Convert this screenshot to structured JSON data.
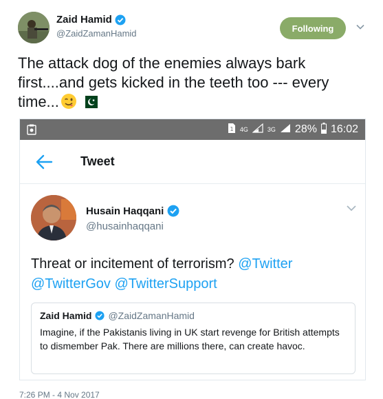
{
  "outer_tweet": {
    "name": "Zaid Hamid",
    "handle": "@ZaidZamanHamid",
    "follow_label": "Following",
    "text": "The attack dog of the enemies always bark first....and gets kicked in the teeth too --- every time...",
    "timestamp": "7:26 PM - 4 Nov 2017"
  },
  "status_bar": {
    "network_4g": "4G",
    "network_3g": "3G",
    "battery": "28%",
    "time": "16:02"
  },
  "app_header": {
    "title": "Tweet"
  },
  "inner_tweet": {
    "name": "Husain Haqqani",
    "handle": "@husainhaqqani",
    "text_plain": "Threat or incitement of terrorism? ",
    "mention1": "@Twitter",
    "mention2": "@TwitterGov",
    "mention3": "@TwitterSupport"
  },
  "quoted_tweet": {
    "name": "Zaid Hamid",
    "handle": "@ZaidZamanHamid",
    "text": "Imagine, if the Pakistanis living in UK start revenge for British attempts to dismember Pak. There are millions there, can create havoc."
  },
  "colors": {
    "follow_button": "#8aab68",
    "link": "#1da1f2",
    "status_bar": "#6d6d6d"
  }
}
